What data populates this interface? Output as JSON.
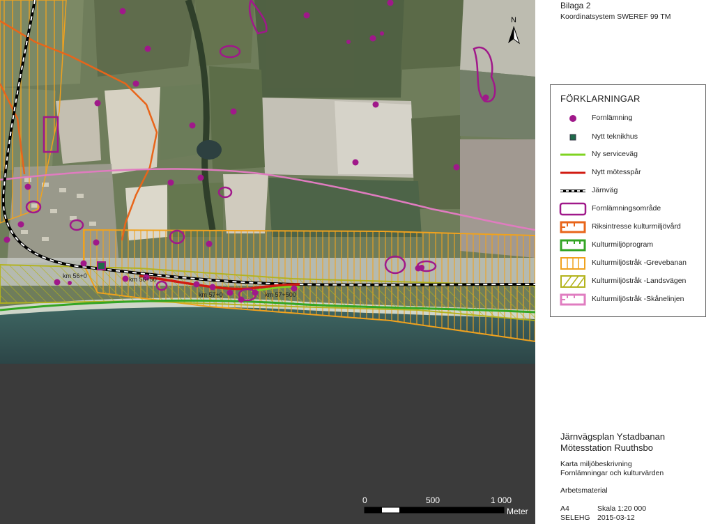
{
  "header": {
    "appendix": "Bilaga 2",
    "coord_system": "Koordinatsystem SWEREF 99 TM"
  },
  "north_arrow": {
    "label": "N",
    "icon": "north-arrow-icon"
  },
  "legend": {
    "title": "FÖRKLARNINGAR",
    "items": [
      {
        "label": "Fornlämning",
        "symbol": "purple-dot",
        "color": "#a0188a"
      },
      {
        "label": "Nytt teknikhus",
        "symbol": "small-square",
        "color": "#1f6a4a"
      },
      {
        "label": "Ny serviceväg",
        "symbol": "green-line",
        "color": "#7fd321"
      },
      {
        "label": "Nytt mötesspår",
        "symbol": "red-line",
        "color": "#d11b12"
      },
      {
        "label": "Järnväg",
        "symbol": "railway-line",
        "color": "#000000"
      },
      {
        "label": "Fornlämningsområde",
        "symbol": "purple-outline",
        "color": "#a0188a"
      },
      {
        "label": "Riksintresse kulturmiljövård",
        "symbol": "hatched-box",
        "color": "#e8651a"
      },
      {
        "label": "Kulturmiljöprogram",
        "symbol": "hatched-box",
        "color": "#33a524"
      },
      {
        "label": "Kulturmiljöstråk -Grevebanan",
        "symbol": "vertical-hatch",
        "color": "#f0a21e"
      },
      {
        "label": "Kulturmiljöstråk -Landsvägen",
        "symbol": "diagonal-hatch",
        "color": "#b3b31c"
      },
      {
        "label": "Kulturmiljöstråk -Skånelinjen",
        "symbol": "hatched-box",
        "color": "#e07cc0"
      }
    ]
  },
  "map_labels": {
    "km1": "km 56+0",
    "km2": "km 56+50",
    "km3": "km 57+0",
    "km4": "km 57+500"
  },
  "project": {
    "title_line1": "Järnvägsplan Ystadbanan",
    "title_line2": "Mötesstation Ruuthsbo",
    "subtitle_line1": "Karta miljöbeskrivning",
    "subtitle_line2": "Fornlämningar och kulturvärden",
    "status": "Arbetsmaterial"
  },
  "scalebar": {
    "ticks": [
      "0",
      "500",
      "1 000"
    ],
    "unit": "Meter"
  },
  "footer": {
    "paper": "A4",
    "scale": "Skala 1:20 000",
    "author": "SELEHG",
    "date": "2015-03-12"
  }
}
